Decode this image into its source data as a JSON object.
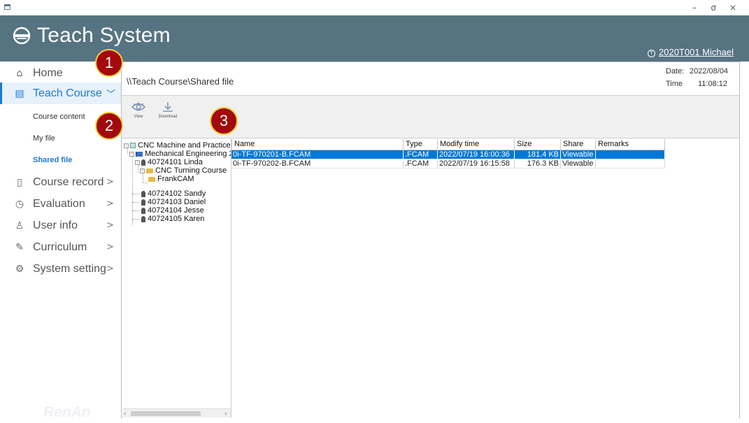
{
  "window": {
    "minimize": "–",
    "maximize": "ơ",
    "close": "×"
  },
  "header": {
    "title": "Teach System",
    "user": "2020T001 Michael",
    "user_icon": "T"
  },
  "sidebar": {
    "items": [
      {
        "label": "Home",
        "icon": "home-icon"
      },
      {
        "label": "Teach Course",
        "icon": "book-icon",
        "chevron": "﹀"
      },
      {
        "label": "Course record",
        "icon": "document-icon",
        "chevron": ">"
      },
      {
        "label": "Evaluation",
        "icon": "clock-icon",
        "chevron": ">"
      },
      {
        "label": "User info",
        "icon": "user-icon",
        "chevron": ">"
      },
      {
        "label": "Curriculum",
        "icon": "pencil-icon",
        "chevron": ">"
      },
      {
        "label": "System setting",
        "icon": "gear-icon",
        "chevron": ">"
      }
    ],
    "sub_items": [
      "Course content",
      "My file",
      "Shared file"
    ],
    "watermark": "RenAn"
  },
  "main": {
    "breadcrumb": "\\\\Teach Course\\Shared file",
    "date_label": "Date:",
    "date_value": "2022/08/04",
    "time_label": "Time",
    "time_value": "11:08:12"
  },
  "toolbar": {
    "view_label": "View",
    "download_label": "Download"
  },
  "tree": {
    "nodes": [
      {
        "label": "CNC Machine and Practice",
        "icon": "database-icon"
      },
      {
        "label": "Mechanical Engineering 2",
        "icon": "flag-icon"
      },
      {
        "label": "40724101 Linda",
        "icon": "user-icon"
      },
      {
        "label": "CNC Turning Course",
        "icon": "folder-icon"
      },
      {
        "label": "FrankCAM",
        "icon": "folder-icon"
      },
      {
        "label": "40724102 Sandy",
        "icon": "user-icon"
      },
      {
        "label": "40724103 Daniel",
        "icon": "user-icon"
      },
      {
        "label": "40724104 Jesse",
        "icon": "user-icon"
      },
      {
        "label": "40724105 Karen",
        "icon": "user-icon"
      }
    ],
    "scroll_left": "‹",
    "scroll_right": "›"
  },
  "files": {
    "columns": [
      "Name",
      "Type",
      "Modify time",
      "Size",
      "Share",
      "Remarks"
    ],
    "rows": [
      {
        "name": "0i-TF-970201-B.FCAM",
        "type": ".FCAM",
        "modified": "2022/07/19 16:00:36",
        "size": "181.4 KB",
        "share": "Viewable",
        "remarks": "",
        "selected": true
      },
      {
        "name": "0i-TF-970202-B.FCAM",
        "type": ".FCAM",
        "modified": "2022/07/19 16:15:58",
        "size": "176.3 KB",
        "share": "Viewable",
        "remarks": "",
        "selected": false
      }
    ]
  },
  "callouts": [
    "1",
    "2",
    "3"
  ],
  "colors": {
    "header_bg": "#567382",
    "accent": "#1a7ad4",
    "selection": "#0078d7",
    "callout_fill": "#a3080b",
    "callout_border": "#f1d235"
  }
}
